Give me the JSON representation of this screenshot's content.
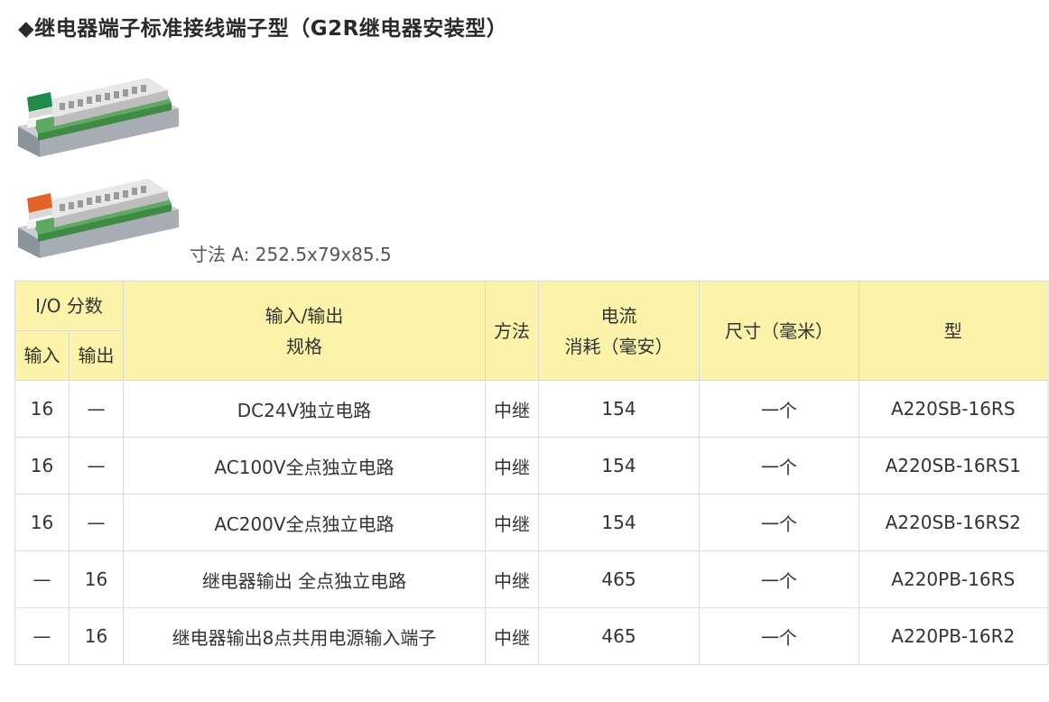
{
  "title": "◆继电器端子标准接线端子型（G2R继电器安装型）",
  "dimension": "寸法 A: 252.5x79x85.5",
  "table": {
    "header": {
      "io_count": "I/O 分数",
      "input": "输入",
      "output": "输出",
      "spec_line1": "输入/输出",
      "spec_line2": "规格",
      "method": "方法",
      "current_line1": "电流",
      "current_line2": "消耗（毫安）",
      "size": "尺寸（毫米）",
      "model": "型"
    },
    "rows": [
      {
        "input": "16",
        "output": "—",
        "spec": "DC24V独立电路",
        "method": "中继",
        "current": "154",
        "size": "一个",
        "model": "A220SB-16RS"
      },
      {
        "input": "16",
        "output": "—",
        "spec": "AC100V全点独立电路",
        "method": "中继",
        "current": "154",
        "size": "一个",
        "model": "A220SB-16RS1"
      },
      {
        "input": "16",
        "output": "—",
        "spec": "AC200V全点独立电路",
        "method": "中继",
        "current": "154",
        "size": "一个",
        "model": "A220SB-16RS2"
      },
      {
        "input": "—",
        "output": "16",
        "spec": "继电器输出 全点独立电路",
        "method": "中继",
        "current": "465",
        "size": "一个",
        "model": "A220PB-16RS"
      },
      {
        "input": "—",
        "output": "16",
        "spec": "继电器输出8点共用电源输入端子",
        "method": "中继",
        "current": "465",
        "size": "一个",
        "model": "A220PB-16R2"
      }
    ]
  },
  "colors": {
    "header_bg": "#fbf3a9",
    "border": "#dcdcdc",
    "label_green": "#1f8a4c",
    "label_orange": "#e2622a"
  }
}
